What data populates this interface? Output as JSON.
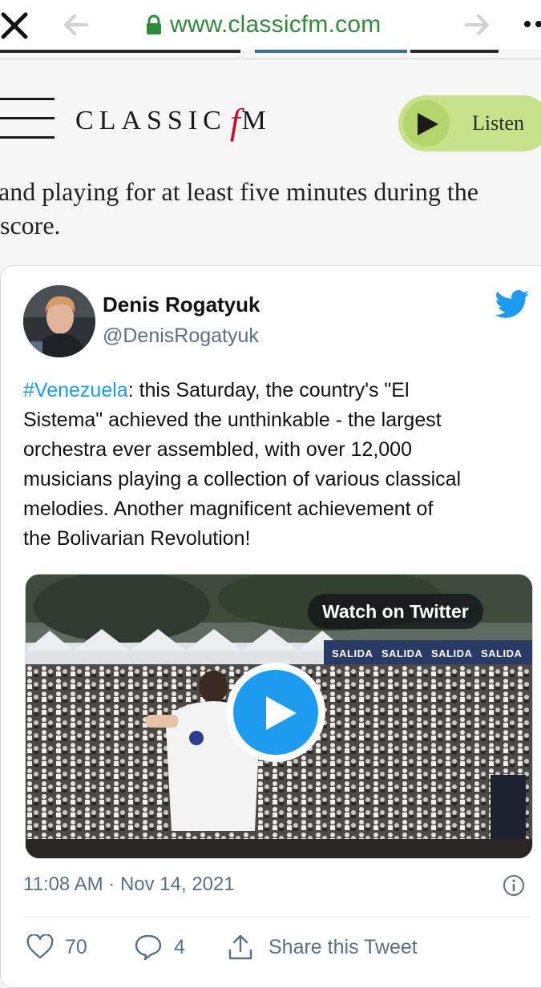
{
  "browser": {
    "url": "www.classicfm.com"
  },
  "site": {
    "logo_word": "CLASSIC",
    "logo_f": "f",
    "logo_m": "M",
    "listen_label": "Listen",
    "colors": {
      "listen_bg": "#c6e28a",
      "logo_accent": "#c8102e"
    }
  },
  "article": {
    "line1": "and playing for at least five minutes during the",
    "line2": "score."
  },
  "tweet": {
    "author_name": "Denis Rogatyuk",
    "author_handle": "@DenisRogatyuk",
    "hashtag": "#Venezuela",
    "text_line1_rest": ": this Saturday, the country's \"El",
    "text_lines": [
      "Sistema\" achieved the unthinkable - the largest",
      "orchestra ever assembled, with over 12,000",
      "musicians playing a collection of various classical",
      "melodies. Another magnificent achievement of",
      "the Bolivarian Revolution!"
    ],
    "video": {
      "watch_label": "Watch on Twitter",
      "banner_text": "SALIDA"
    },
    "timestamp": "11:08 AM · Nov 14, 2021",
    "likes": "70",
    "replies": "4",
    "share_label": "Share this Tweet",
    "colors": {
      "link": "#1d9bf0",
      "muted": "#5b7083"
    }
  }
}
